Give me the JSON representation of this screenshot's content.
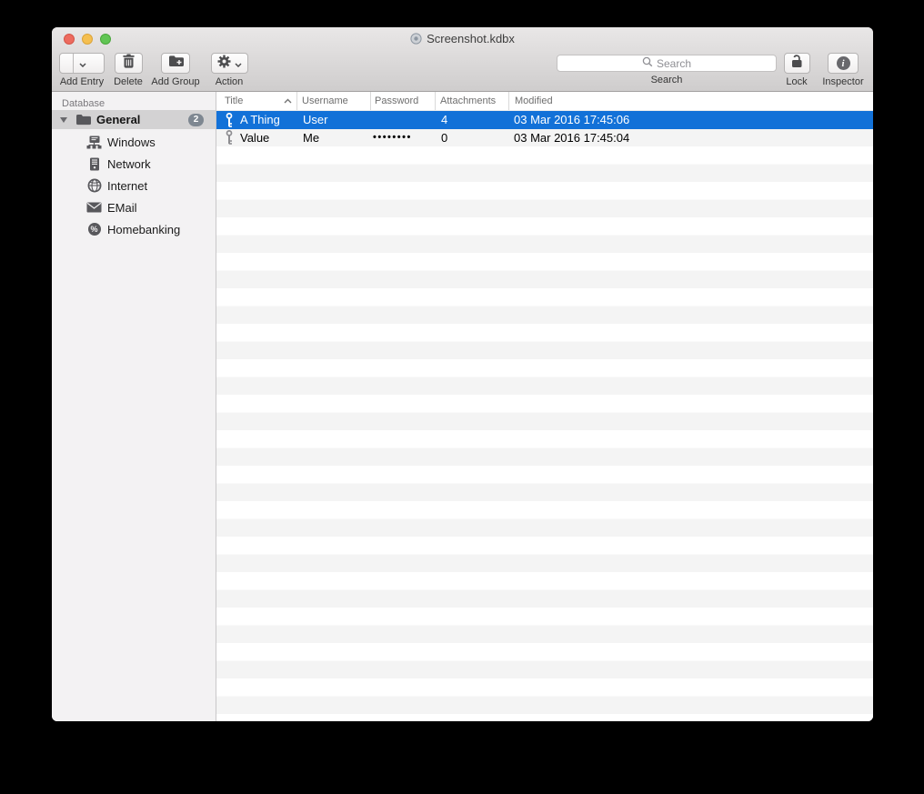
{
  "window": {
    "title": "Screenshot.kdbx"
  },
  "toolbar": {
    "add_entry_label": "Add Entry",
    "delete_label": "Delete",
    "add_group_label": "Add Group",
    "action_label": "Action",
    "search_label": "Search",
    "search_placeholder": "Search",
    "lock_label": "Lock",
    "inspector_label": "Inspector"
  },
  "sidebar": {
    "header": "Database",
    "groups": [
      {
        "label": "General",
        "badge": "2",
        "selected": true,
        "expanded": true,
        "icon": "folder-icon",
        "children": [
          {
            "label": "Windows",
            "icon": "windows-icon"
          },
          {
            "label": "Network",
            "icon": "network-server-icon"
          },
          {
            "label": "Internet",
            "icon": "globe-icon"
          },
          {
            "label": "EMail",
            "icon": "envelope-icon"
          },
          {
            "label": "Homebanking",
            "icon": "percent-icon"
          }
        ]
      }
    ]
  },
  "table": {
    "columns": [
      "Title",
      "Username",
      "Password",
      "Attachments",
      "Modified"
    ],
    "sort": {
      "column": "Title",
      "direction": "ascending"
    },
    "rows": [
      {
        "title": "A Thing",
        "username": "User",
        "password": "",
        "attachments": "4",
        "modified": "03 Mar 2016 17:45:06",
        "selected": true,
        "icon": "key-icon"
      },
      {
        "title": "Value",
        "username": "Me",
        "password": "••••••••",
        "attachments": "0",
        "modified": "03 Mar 2016 17:45:04",
        "selected": false,
        "icon": "key-icon"
      }
    ]
  },
  "icons": {
    "add_entry": "key-plus-icon",
    "add_entry_arrow": "chevron-down-icon",
    "delete": "trash-icon",
    "add_group": "folder-plus-icon",
    "action": "gear-icon",
    "search": "magnifier-icon",
    "lock": "open-padlock-icon",
    "inspector": "info-circle-icon",
    "title_proxy": "document-proxy-icon"
  },
  "colors": {
    "selection_blue": "#1271d8",
    "stripe_gray": "#f4f4f4",
    "sidebar_selection": "#d3d2d3",
    "traffic_red": "#ed6b5f",
    "traffic_yellow": "#f5bf50",
    "traffic_green": "#61c554"
  }
}
